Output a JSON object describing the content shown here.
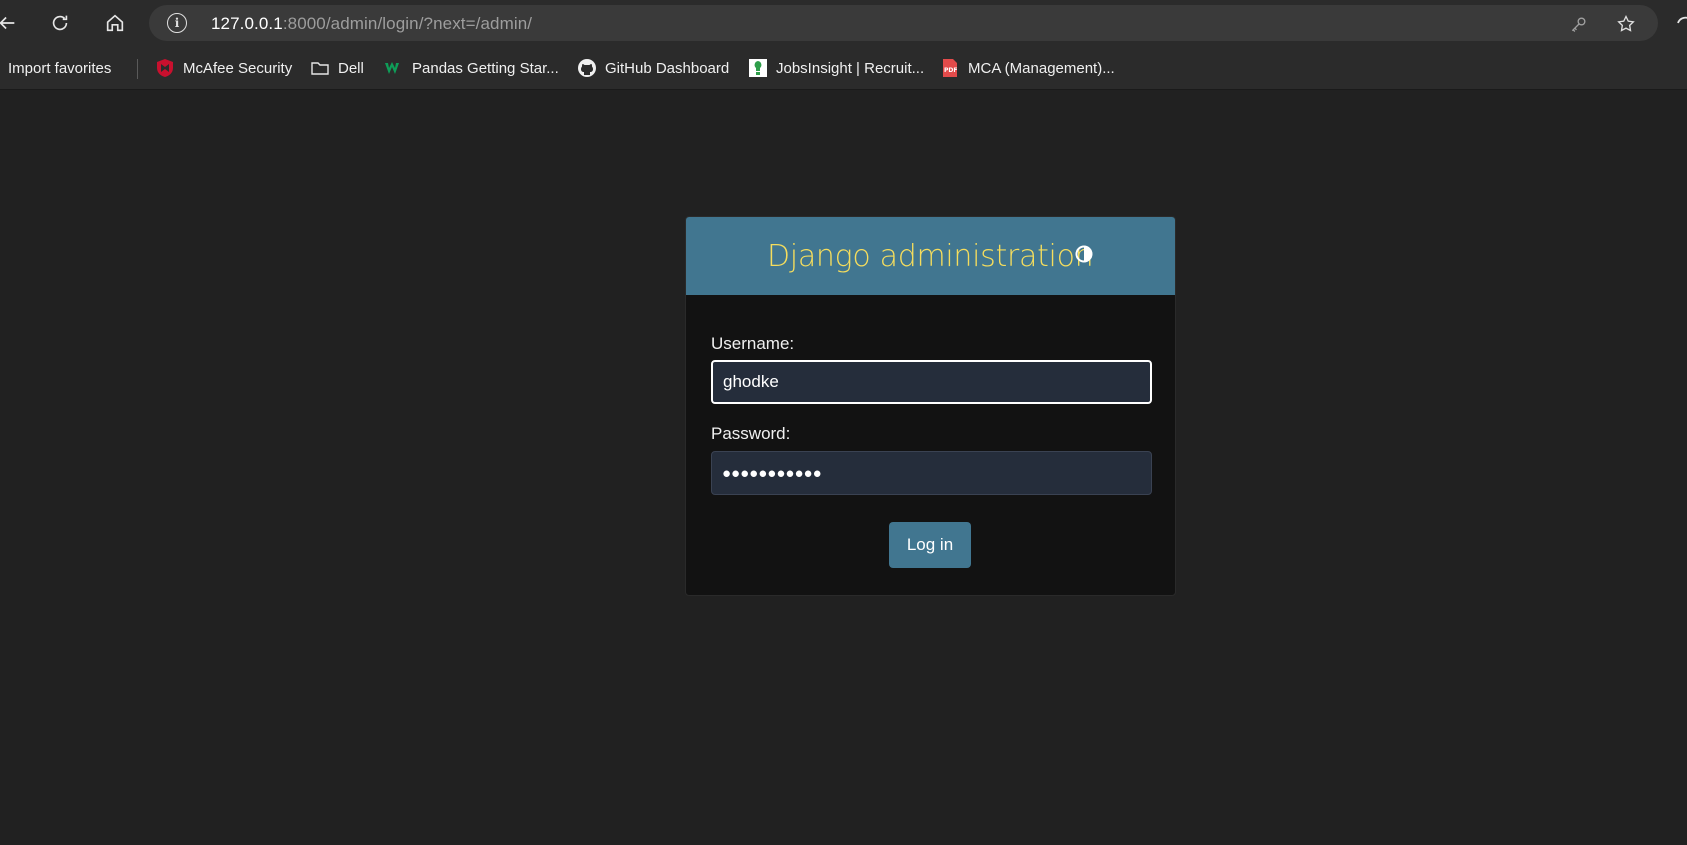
{
  "browser": {
    "url_host": "127.0.0.1",
    "url_rest": ":8000/admin/login/?next=/admin/"
  },
  "bookmarks": [
    {
      "label": "Import favorites",
      "icon": "import-icon"
    },
    {
      "label": "McAfee Security",
      "icon": "mcafee-icon"
    },
    {
      "label": "Dell",
      "icon": "folder-icon"
    },
    {
      "label": "Pandas Getting Star...",
      "icon": "w-logo-icon"
    },
    {
      "label": "GitHub Dashboard",
      "icon": "github-icon"
    },
    {
      "label": "JobsInsight | Recruit...",
      "icon": "jobsinsight-icon"
    },
    {
      "label": "MCA (Management)...",
      "icon": "pdf-icon"
    }
  ],
  "login": {
    "site_title": "Django administration",
    "username_label": "Username:",
    "username_value": "ghodke",
    "password_label": "Password:",
    "password_value": "●●●●●●●●●●●",
    "submit_label": "Log in"
  },
  "colors": {
    "header_bg": "#417690",
    "title_color": "#f5dd5d",
    "page_bg": "#212121",
    "card_bg": "#121212",
    "input_bg": "#252d3b"
  }
}
